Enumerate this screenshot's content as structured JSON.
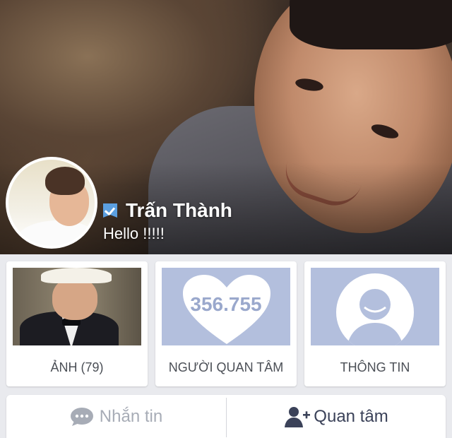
{
  "profile": {
    "name": "Trấn Thành",
    "status": "Hello !!!!!",
    "verified_icon": "verified-badge-icon"
  },
  "cards": [
    {
      "label": "ẢNH (79)",
      "icon": "photo-thumbnail"
    },
    {
      "label": "NGƯỜI QUAN TÂM",
      "count": "356.755",
      "icon": "heart-icon"
    },
    {
      "label": "THÔNG TIN",
      "icon": "person-icon"
    }
  ],
  "actions": {
    "message_label": "Nhắn tin",
    "follow_label": "Quan tâm"
  },
  "colors": {
    "accent": "#5b9fe0",
    "card_blue": "#b3bfdd",
    "text_dark": "#3b4259",
    "text_muted": "#a7acb6"
  }
}
